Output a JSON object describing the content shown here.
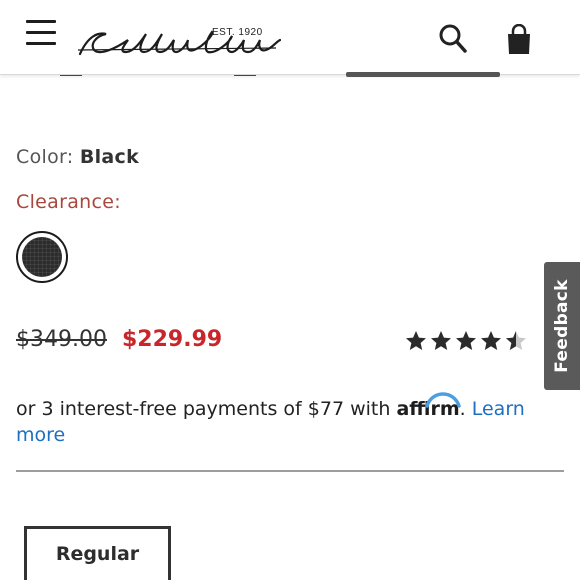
{
  "header": {
    "logo_text": "Eddie Bauer",
    "logo_est": "EST. 1920",
    "menu_icon": "hamburger-menu-icon",
    "search_icon": "search-icon",
    "bag_icon": "shopping-bag-icon"
  },
  "product": {
    "color_label": "Color:",
    "color_value": "Black",
    "clearance_label": "Clearance:",
    "swatch_name": "Black",
    "original_price": "$349.00",
    "sale_price": "$229.99",
    "rating": 4.5,
    "rating_max": 5
  },
  "feedback": {
    "label": "Feedback"
  },
  "affirm": {
    "text": "or 3 interest-free payments of $77 with",
    "logo": "affirm",
    "period": ".",
    "learn_more": "Learn more"
  },
  "fit": {
    "selected": "Regular"
  },
  "colors": {
    "sale_red": "#c8262b",
    "clearance_red": "#a8473d",
    "link_blue": "#1e6fc0",
    "affirm_blue": "#4a9fe3",
    "feedback_bg": "#5a5a5a"
  }
}
